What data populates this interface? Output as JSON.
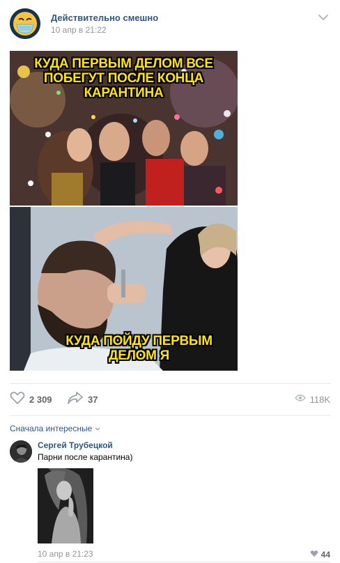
{
  "post": {
    "author": "Действительно смешно",
    "date": "10 апр в 21:22",
    "images": [
      {
        "caption": "КУДА ПЕРВЫМ ДЕЛОМ ВСЕ\nПОБЕГУТ ПОСЛЕ КОНЦА\nКАРАНТИНА"
      },
      {
        "caption": "КУДА ПОЙДУ ПЕРВЫМ\nДЕЛОМ Я"
      }
    ],
    "likes": "2 309",
    "shares": "37",
    "views": "118K"
  },
  "comments_sort": "Сначала интересные",
  "comment": {
    "author": "Сергей Трубецкой",
    "text": "Парни после карантина)",
    "date": "10 апр в 21:23",
    "likes": "44"
  },
  "icons": {
    "like": "heart-outline-icon",
    "share": "share-arrow-icon",
    "views": "eye-icon",
    "menu": "chevron-down-icon",
    "sort": "chevron-down-icon",
    "comment_like": "heart-filled-icon"
  },
  "colors": {
    "link": "#2a5885",
    "meta": "#939393",
    "icon": "#99a2ad",
    "caption": "#ffe600"
  }
}
